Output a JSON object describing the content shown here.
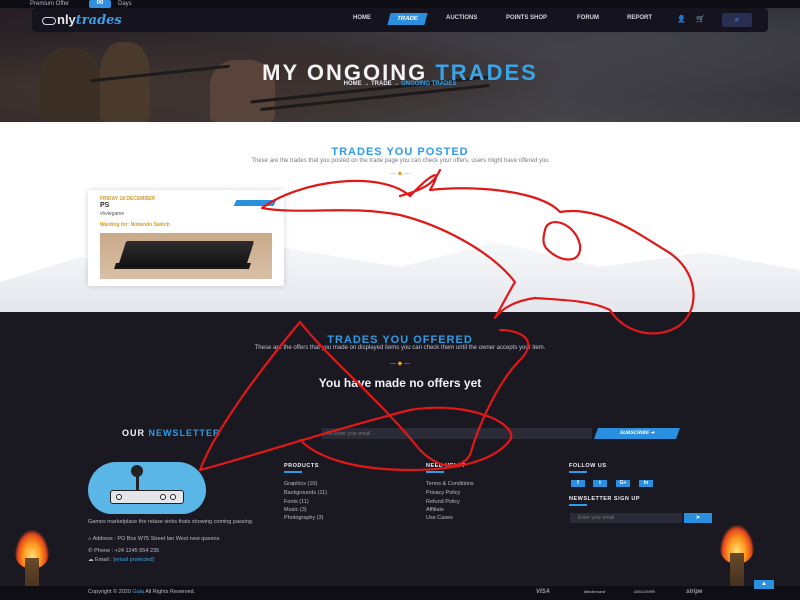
{
  "topstrip": {
    "promo": "Premium Offer",
    "counter": "00",
    "days": "Days"
  },
  "nav": {
    "logo_prefix": "nly",
    "logo_script": "trades",
    "items": [
      "HOME",
      "TRADE",
      "AUCTIONS",
      "POINTS SHOP",
      "FORUM",
      "REPORT"
    ],
    "user_icon": "user-icon",
    "cart_icon": "cart-icon",
    "search_icon": "search-icon"
  },
  "hero": {
    "title_main": "MY ONGOING",
    "title_highlight": "TRADES",
    "crumb_home": "HOME",
    "crumb_sep": "→",
    "crumb_trade": "TRADE",
    "crumb_current": "ONGOING TRADES"
  },
  "posted": {
    "title": "TRADES YOU POSTED",
    "subtitle": "These are the trades that you posted on the trade page you can check your offers, users might have offered you",
    "card": {
      "date": "FRIDAY 18 DECEMBER",
      "title": "PS",
      "owner": "vhvlegame",
      "want": "Wanting for: Nintendo Switch"
    }
  },
  "offered": {
    "title": "TRADES YOU OFFERED",
    "subtitle": "These are the offers that you made on displayed items you can check them until the owner accepts your item.",
    "empty": "You have made no offers yet"
  },
  "newsletter": {
    "title_main": "OUR",
    "title_highlight": "NEWSLETTER",
    "placeholder": "Enter your email",
    "button": "SUBSCRIBE ➜"
  },
  "footer": {
    "about": "Games marketplace the relaxe sinks thats showing coming passing.",
    "address": "Address : PO Box W75 Street lan West new queens",
    "phone": "Phone : +24 1245 654 235",
    "email_label": "Email :",
    "email": "[email protected]",
    "products": {
      "head": "PRODUCTS",
      "items": [
        "Graphics (10)",
        "Backgrounds (11)",
        "Fonts (11)",
        "Music (3)",
        "Photography (3)"
      ]
    },
    "help": {
      "head": "NEED HELP?",
      "items": [
        "Terms & Conditions",
        "Privacy Policy",
        "Refund Policy",
        "Affiliate",
        "Use Cases"
      ]
    },
    "follow": {
      "head": "FOLLOW US",
      "items": [
        "f",
        "t",
        "G+",
        "in"
      ]
    },
    "signup": {
      "head": "NEWSLETTER SIGN UP",
      "placeholder": "Enter your email",
      "button": "➤"
    }
  },
  "bottom": {
    "copyright_prefix": "Copyright © 2020",
    "copyright_brand": "Gala",
    "copyright_suffix": "All Rights Reserved.",
    "payments": [
      "VISA",
      "Mastercard",
      "DISCOVER",
      "stripe"
    ],
    "to_top": "▲"
  },
  "colors": {
    "accent": "#2a8fdf",
    "highlight_orange": "#e8a322",
    "scribble": "#e01818",
    "dark_bg": "#1a1922"
  }
}
